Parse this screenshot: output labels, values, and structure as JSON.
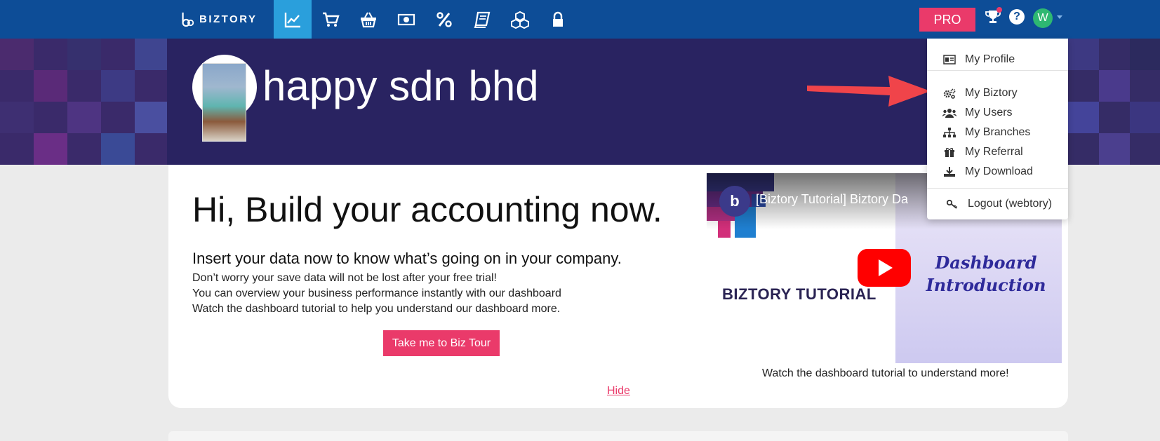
{
  "brand": {
    "name": "BIZTORY"
  },
  "nav": {
    "icons": [
      "chart-line-icon",
      "cart-icon",
      "basket-icon",
      "money-icon",
      "percent-icon",
      "book-icon",
      "cubes-icon",
      "lock-icon"
    ],
    "active_index": 0
  },
  "header": {
    "pro_label": "PRO",
    "avatar_initial": "W"
  },
  "banner": {
    "company_name": "happy sdn bhd"
  },
  "welcome": {
    "headline": "Hi, Build your accounting now.",
    "subhead": "Insert your data now to know what’s going on in your company.",
    "lines": [
      "Don’t worry your save data will not be lost after your free trial!",
      "You can overview your business performance instantly with our dashboard",
      "Watch the dashboard tutorial to help you understand our dashboard more."
    ],
    "tour_button": "Take me to Biz Tour",
    "hide_link": "Hide"
  },
  "video": {
    "title": "[Biztory Tutorial] Biztory Da",
    "brand_text": "BIZTORY TUTORIAL",
    "script_line1": "Dashboard",
    "script_line2": "Introduction",
    "caption": "Watch the dashboard tutorial to understand more!"
  },
  "dropdown": {
    "items": [
      {
        "label": "My Profile",
        "icon": "id-card-icon"
      },
      {
        "label": "My Biztory",
        "icon": "cogs-icon"
      },
      {
        "label": "My Users",
        "icon": "users-icon"
      },
      {
        "label": "My Branches",
        "icon": "sitemap-icon"
      },
      {
        "label": "My Referral",
        "icon": "gift-icon"
      },
      {
        "label": "My Download",
        "icon": "download-icon"
      },
      {
        "label": "Logout (webtory)",
        "icon": "key-icon"
      }
    ]
  },
  "colors": {
    "nav_bg": "#0d4d97",
    "nav_active": "#2a9fdc",
    "accent": "#ea3a6a",
    "banner_bg": "#292361"
  }
}
